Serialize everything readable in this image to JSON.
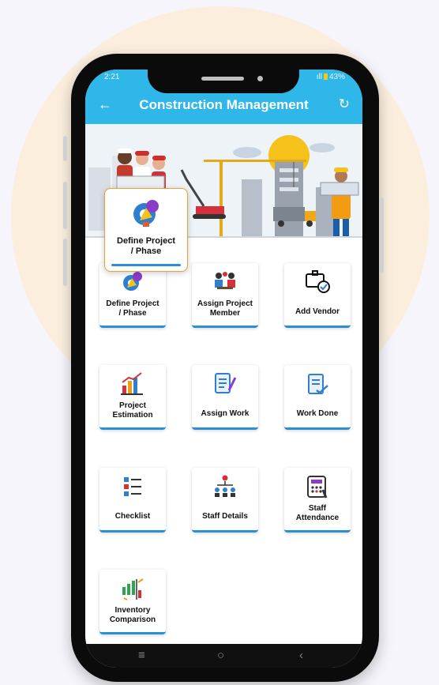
{
  "status_bar": {
    "time": "2:21",
    "signal": "ıll",
    "battery": "43%"
  },
  "app_bar": {
    "back_icon": "back-arrow-icon",
    "title": "Construction Management",
    "refresh_icon": "refresh-icon"
  },
  "highlighted_card": {
    "label": "Define Project\n/ Phase",
    "icon": "gear-bulb-icon"
  },
  "menu": [
    {
      "label": "Define Project\n/ Phase",
      "icon": "gear-bulb-icon"
    },
    {
      "label": "Assign Project\nMember",
      "icon": "team-meeting-icon"
    },
    {
      "label": "Add Vendor",
      "icon": "vendor-handshake-icon"
    },
    {
      "label": "Project\nEstimation",
      "icon": "chart-growth-icon"
    },
    {
      "label": "Assign Work",
      "icon": "clipboard-pen-icon"
    },
    {
      "label": "Work Done",
      "icon": "checklist-done-icon"
    },
    {
      "label": "Checklist",
      "icon": "checklist-icon"
    },
    {
      "label": "Staff Details",
      "icon": "org-chart-icon"
    },
    {
      "label": "Staff\nAttendance",
      "icon": "attendance-keypad-icon"
    },
    {
      "label": "Inventory\nComparison",
      "icon": "inventory-compare-icon"
    }
  ],
  "nav_bar": {
    "menu_icon": "≡",
    "home_icon": "○",
    "back_icon": "‹"
  }
}
